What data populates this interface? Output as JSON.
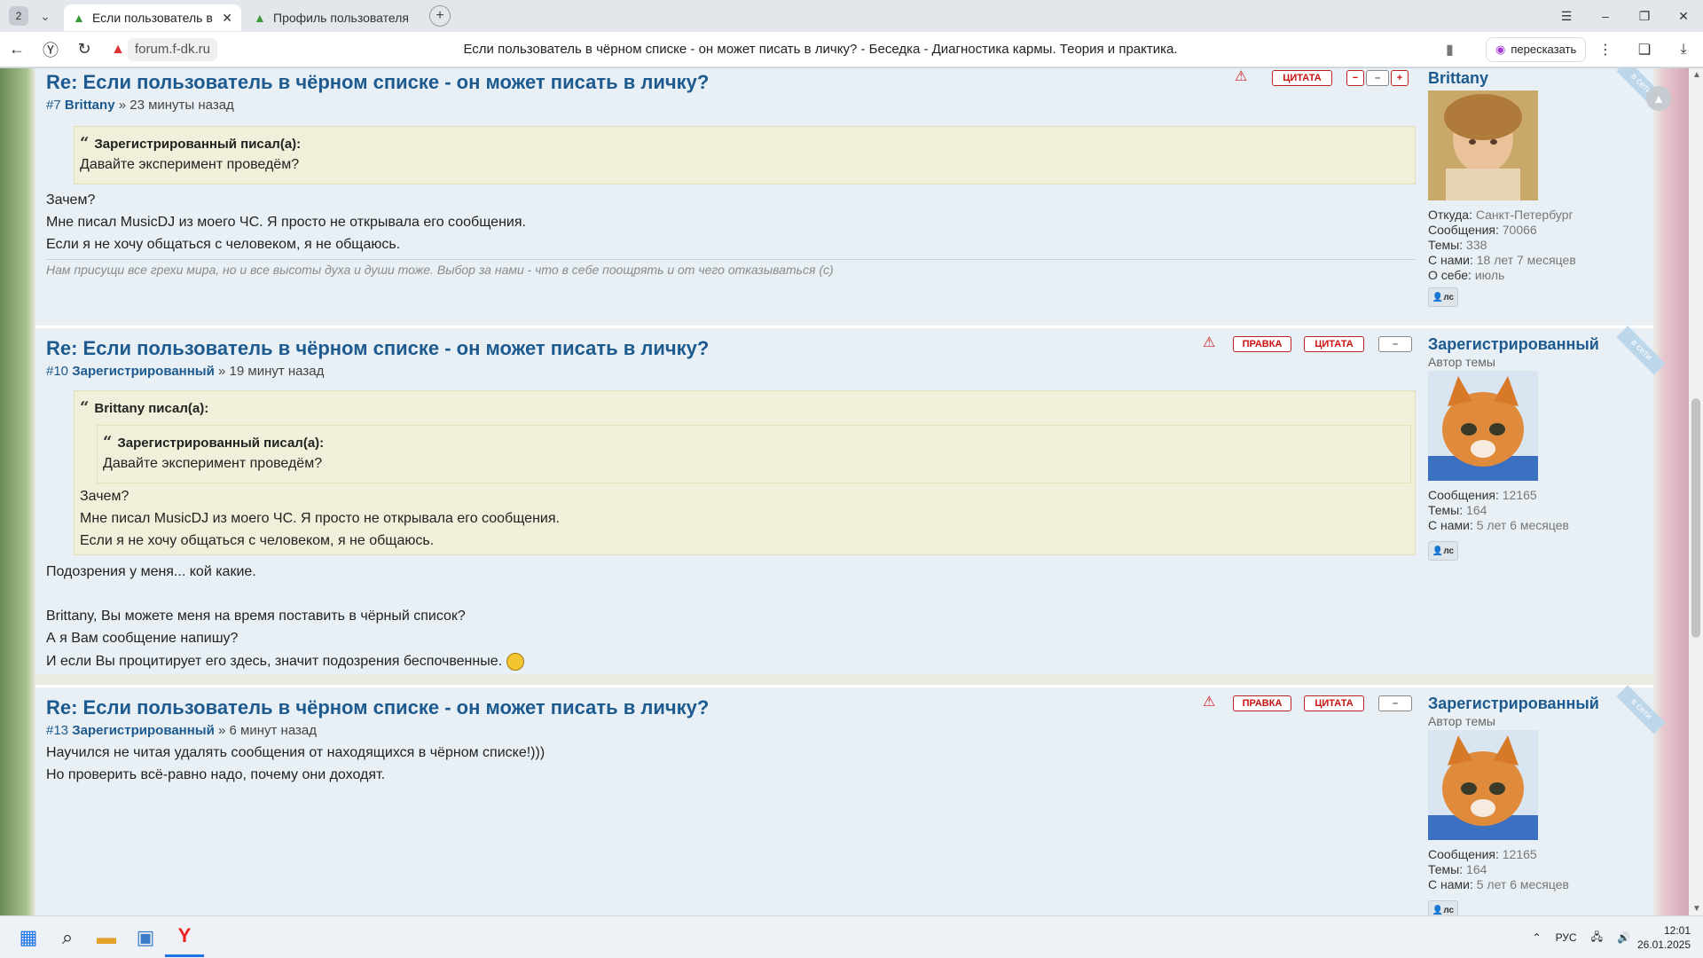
{
  "browser": {
    "tab_count": "2",
    "tabs": [
      {
        "title": "Если пользователь в чё"
      },
      {
        "title": "Профиль пользователя В"
      }
    ],
    "domain": "forum.f-dk.ru",
    "page_title": "Если пользователь в чёрном списке - он может писать в личку? - Беседка - Диагностика кармы. Теория и практика.",
    "retell_label": "пересказать"
  },
  "posts": [
    {
      "title": "Re: Если пользователь в чёрном списке - он может писать в личку?",
      "num": "#7",
      "author": "Brittany",
      "time": "» 23 минуты назад",
      "quote_author": "Зарегистрированный писал(а):",
      "quote_text": "Давайте эксперимент проведём?",
      "lines": [
        "Зачем?",
        "Мне писал MusicDJ из моего ЧС. Я просто не открывала его сообщения.",
        "Если я не хочу общаться с человеком, я не общаюсь."
      ],
      "signature": "Нам присущи все грехи мира, но и все высоты духа и души тоже. Выбор за нами - что в себе поощрять и от чего отказываться (с)",
      "user": {
        "name": "Brittany",
        "stats": [
          {
            "k": "Откуда:",
            "v": "Санкт-Петербург"
          },
          {
            "k": "Сообщения:",
            "v": "70066"
          },
          {
            "k": "Темы:",
            "v": "338"
          },
          {
            "k": "С нами:",
            "v": "18 лет 7 месяцев"
          },
          {
            "k": "О себе:",
            "v": "июль"
          }
        ]
      }
    },
    {
      "title": "Re: Если пользователь в чёрном списке - он может писать в личку?",
      "num": "#10",
      "author": "Зарегистрированный",
      "time": "» 19 минут назад",
      "quote_author": "Brittany писал(а):",
      "inner_quote_author": "Зарегистрированный писал(а):",
      "inner_quote_text": "Давайте эксперимент проведём?",
      "quote_lines": [
        "Зачем?",
        "Мне писал MusicDJ из моего ЧС. Я просто не открывала его сообщения.",
        "Если я не хочу общаться с человеком, я не общаюсь."
      ],
      "lines": [
        "Подозрения у меня... кой какие.",
        "Brittany, Вы можете меня на время поставить в чёрный список?",
        "А я Вам сообщение напишу?",
        "И если Вы процитирует его здесь, значит подозрения беспочвенные."
      ],
      "user": {
        "name": "Зарегистрированный",
        "role": "Автор темы",
        "stats": [
          {
            "k": "Сообщения:",
            "v": "12165"
          },
          {
            "k": "Темы:",
            "v": "164"
          },
          {
            "k": "С нами:",
            "v": "5 лет 6 месяцев"
          }
        ]
      }
    },
    {
      "title": "Re: Если пользователь в чёрном списке - он может писать в личку?",
      "num": "#13",
      "author": "Зарегистрированный",
      "time": "» 6 минут назад",
      "lines": [
        "Научился не читая удалять сообщения от находящихся в чёрном списке!)))",
        "Но проверить всё-равно надо, почему они доходят."
      ],
      "user": {
        "name": "Зарегистрированный",
        "role": "Автор темы",
        "stats": [
          {
            "k": "Сообщения:",
            "v": "12165"
          },
          {
            "k": "Темы:",
            "v": "164"
          },
          {
            "k": "С нами:",
            "v": "5 лет 6 месяцев"
          }
        ]
      }
    }
  ],
  "buttons": {
    "quote": "ЦИТАТА",
    "edit": "ПРАВКА",
    "pm": "лс",
    "online": "в сети"
  },
  "tray": {
    "lang": "РУС",
    "time": "12:01",
    "date": "26.01.2025"
  },
  "colors": {
    "title_blue": "#1d5a8f",
    "post_bg": "#e8f0f5",
    "quote_bg": "#f0efd9",
    "button_red": "#c11"
  }
}
